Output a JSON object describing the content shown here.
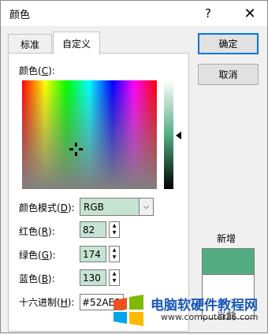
{
  "window": {
    "title": "颜色",
    "help": "?",
    "close": "✕"
  },
  "tabs": [
    {
      "label": "标准",
      "active": false
    },
    {
      "label": "自定义",
      "active": true
    }
  ],
  "colors_label": {
    "text": "颜色(",
    "mnemonic": "C",
    "suffix": "):"
  },
  "mode": {
    "label": "颜色模式(",
    "mnemonic": "D",
    "suffix": "):",
    "value": "RGB"
  },
  "red": {
    "label": "红色(",
    "mnemonic": "R",
    "suffix": "):",
    "value": "82"
  },
  "green": {
    "label": "绿色(",
    "mnemonic": "G",
    "suffix": "):",
    "value": "174"
  },
  "blue": {
    "label": "蓝色(",
    "mnemonic": "B",
    "suffix": "):",
    "value": "130"
  },
  "hex": {
    "label": "十六进制(",
    "mnemonic": "H",
    "suffix": "):",
    "value": "#52AE82"
  },
  "buttons": {
    "ok": "确定",
    "cancel": "取消"
  },
  "preview": {
    "new_label": "新增",
    "current_label": "当前",
    "new_color": "#52ae82",
    "current_color": "#ffffff"
  },
  "watermark": {
    "title": "电脑软硬件教程网",
    "url": "www.computer26.com"
  }
}
